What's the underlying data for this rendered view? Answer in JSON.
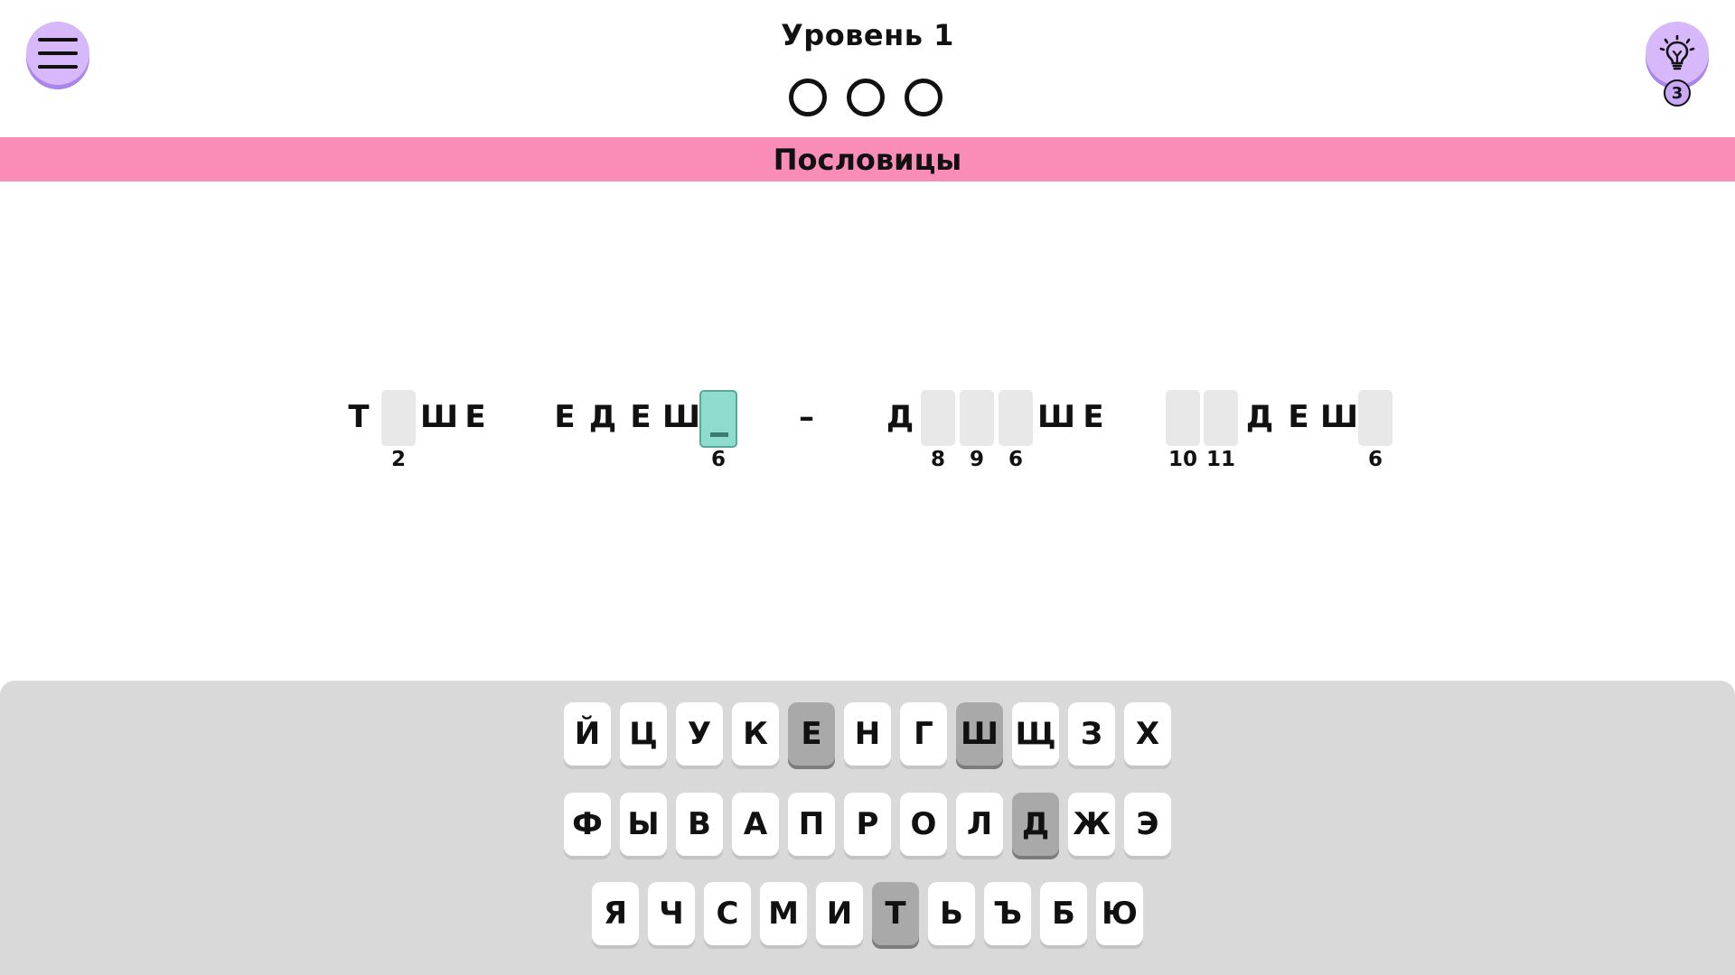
{
  "header": {
    "level_title": "Уровень 1",
    "progress_dots": 3,
    "hint_count": "3",
    "menu_icon": "hamburger-icon",
    "hint_icon": "lightbulb-icon"
  },
  "category": "Пословицы",
  "puzzle": {
    "cells": [
      {
        "letter": "Т"
      },
      {
        "letter": "",
        "num": "2"
      },
      {
        "letter": "Ш"
      },
      {
        "letter": "Е"
      },
      {
        "letter": "Е"
      },
      {
        "letter": "Д"
      },
      {
        "letter": "Е"
      },
      {
        "letter": "Ш"
      },
      {
        "letter": "",
        "num": "6",
        "active": true
      },
      {
        "letter": "Д"
      },
      {
        "letter": "",
        "num": "8"
      },
      {
        "letter": "",
        "num": "9"
      },
      {
        "letter": "",
        "num": "6"
      },
      {
        "letter": "Ш"
      },
      {
        "letter": "Е"
      },
      {
        "letter": "",
        "num": "10"
      },
      {
        "letter": "",
        "num": "11"
      },
      {
        "letter": "Д"
      },
      {
        "letter": "Е"
      },
      {
        "letter": "Ш"
      },
      {
        "letter": "",
        "num": "6"
      }
    ],
    "dash": "–"
  },
  "keyboard": {
    "rows": [
      [
        "Й",
        "Ц",
        "У",
        "К",
        "Е",
        "Н",
        "Г",
        "Ш",
        "Щ",
        "З",
        "Х"
      ],
      [
        "Ф",
        "Ы",
        "В",
        "А",
        "П",
        "Р",
        "О",
        "Л",
        "Д",
        "Ж",
        "Э"
      ],
      [
        "Я",
        "Ч",
        "С",
        "М",
        "И",
        "Т",
        "Ь",
        "Ъ",
        "Б",
        "Ю"
      ]
    ],
    "used": [
      "Е",
      "Ш",
      "Д",
      "Т"
    ]
  },
  "colors": {
    "accent_purple": "#d6b8fb",
    "category_pink": "#f98db6",
    "active_cell": "#8fdccf",
    "used_key": "#a9a9a9"
  }
}
